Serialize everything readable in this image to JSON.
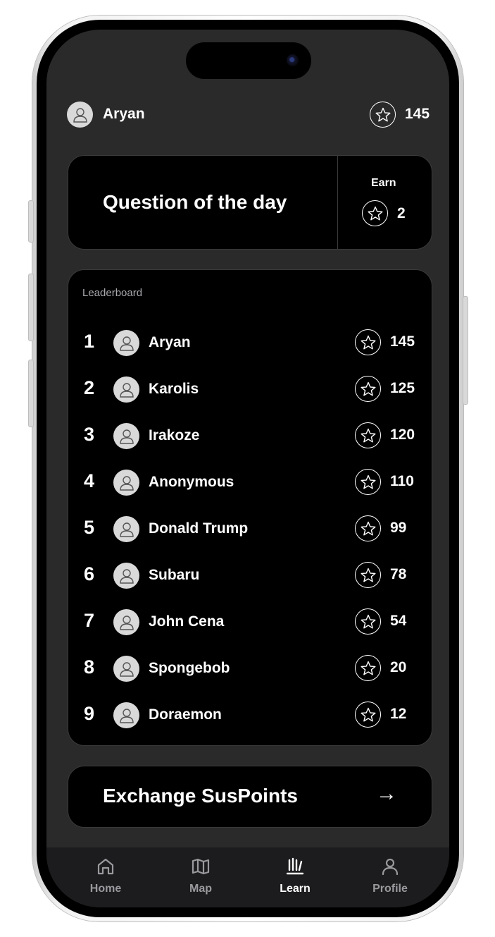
{
  "header": {
    "user_name": "Aryan",
    "points": "145"
  },
  "question_card": {
    "title": "Question of the day",
    "earn_label": "Earn",
    "earn_points": "2"
  },
  "leaderboard": {
    "title": "Leaderboard",
    "rows": [
      {
        "rank": "1",
        "name": "Aryan",
        "points": "145"
      },
      {
        "rank": "2",
        "name": "Karolis",
        "points": "125"
      },
      {
        "rank": "3",
        "name": "Irakoze",
        "points": "120"
      },
      {
        "rank": "4",
        "name": "Anonymous",
        "points": "110"
      },
      {
        "rank": "5",
        "name": "Donald Trump",
        "points": "99"
      },
      {
        "rank": "6",
        "name": "Subaru",
        "points": "78"
      },
      {
        "rank": "7",
        "name": "John Cena",
        "points": "54"
      },
      {
        "rank": "8",
        "name": "Spongebob",
        "points": "20"
      },
      {
        "rank": "9",
        "name": "Doraemon",
        "points": "12"
      }
    ]
  },
  "exchange": {
    "label": "Exchange SusPoints",
    "arrow": "→"
  },
  "tabbar": {
    "items": [
      {
        "label": "Home",
        "icon": "home-icon",
        "active": false
      },
      {
        "label": "Map",
        "icon": "map-icon",
        "active": false
      },
      {
        "label": "Learn",
        "icon": "learn-icon",
        "active": true
      },
      {
        "label": "Profile",
        "icon": "profile-icon",
        "active": false
      }
    ],
    "active_color": "#ffffff",
    "inactive_color": "#9a9a9e"
  },
  "colors": {
    "background": "#2a2a2a",
    "card": "#000000",
    "accent": "#ffffff"
  }
}
